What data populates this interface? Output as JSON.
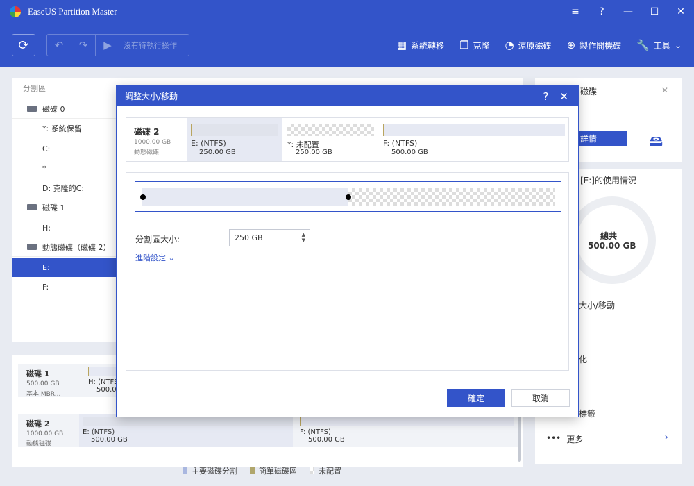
{
  "app": {
    "title": "EaseUS Partition Master"
  },
  "window_controls": {
    "menu": "≡",
    "help": "?",
    "minimize": "—",
    "maximize": "☐",
    "close": "✕"
  },
  "toolbar": {
    "pending_label": "沒有待執行操作",
    "actions": [
      {
        "label": "系統轉移",
        "icon": "grid-icon"
      },
      {
        "label": "克隆",
        "icon": "copy-icon"
      },
      {
        "label": "還原磁碟",
        "icon": "pie-icon"
      },
      {
        "label": "製作開機碟",
        "icon": "plus-circle-icon"
      },
      {
        "label": "工具",
        "icon": "wrench-icon"
      }
    ]
  },
  "partition_list": {
    "col_partition": "分割區",
    "rows": [
      {
        "label": "磁碟 0",
        "type": "disk"
      },
      {
        "label": "*: 系統保留",
        "type": "part"
      },
      {
        "label": "C:",
        "type": "part"
      },
      {
        "label": "*",
        "type": "part"
      },
      {
        "label": "D: 克隆的C:",
        "type": "part"
      },
      {
        "label": "磁碟 1",
        "type": "disk"
      },
      {
        "label": "H:",
        "type": "part"
      },
      {
        "label": "動態磁碟（磁碟 2）",
        "type": "disk"
      },
      {
        "label": "E:",
        "type": "part",
        "selected": true
      },
      {
        "label": "F:",
        "type": "part"
      }
    ]
  },
  "disk_map": {
    "disk1": {
      "name": "磁碟 1",
      "size": "500.00 GB",
      "type": "基本 MBR...",
      "partition": {
        "name": "H: (NTFS)",
        "size": "500.00"
      }
    },
    "disk2": {
      "name": "磁碟 2",
      "size": "1000.00 GB",
      "type": "動態磁碟",
      "partitions": [
        {
          "name": "E: (NTFS)",
          "size": "500.00 GB"
        },
        {
          "name": "F: (NTFS)",
          "size": "500.00 GB"
        }
      ]
    }
  },
  "legend": {
    "primary": "主要磁碟分割",
    "simple": "簡單磁碟區",
    "unallocated": "未配置"
  },
  "right_panel": {
    "title_fragment": "磁碟",
    "close": "✕",
    "details_button": "詳情",
    "usage_title": "[E:]的使用情況",
    "total_label": "總共",
    "total_value": "500.00 GB",
    "items": [
      "大小/移動",
      "化",
      "標籤"
    ],
    "more": "更多"
  },
  "dialog": {
    "title": "調整大小/移動",
    "help": "?",
    "close": "✕",
    "disk": {
      "name": "磁碟 2",
      "size": "1000.00 GB",
      "type": "動態磁碟"
    },
    "partitions": [
      {
        "name": "E: (NTFS)",
        "size": "250.00 GB"
      },
      {
        "name": "*: 未配置",
        "size": "250.00 GB"
      },
      {
        "name": "F: (NTFS)",
        "size": "500.00 GB"
      }
    ],
    "slider_fraction": 0.5,
    "size_label": "分割區大小:",
    "size_value": "250 GB",
    "advanced": "進階設定",
    "ok": "確定",
    "cancel": "取消"
  }
}
